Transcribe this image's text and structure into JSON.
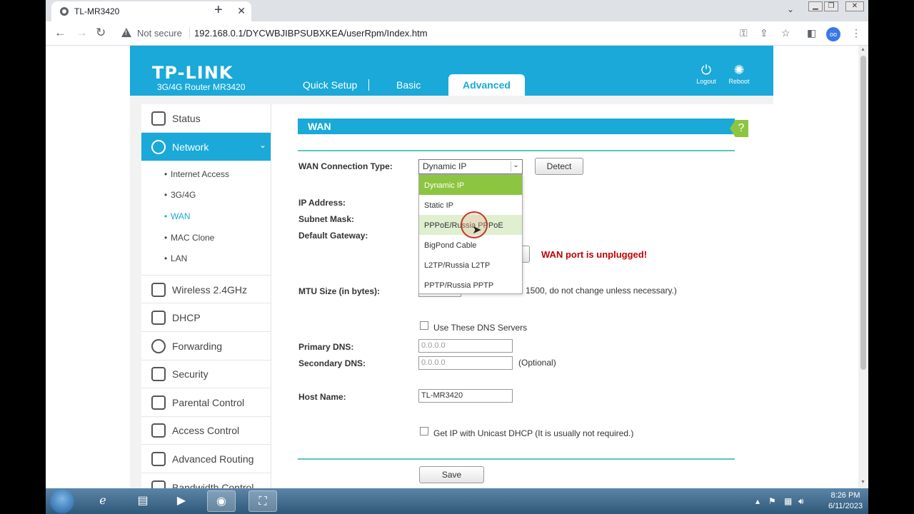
{
  "browser": {
    "tab_title": "TL-MR3420",
    "tab_close": "✕",
    "new_tab": "+",
    "tab_search": "⌄",
    "security_label": "Not secure",
    "url": "192.168.0.1/DYCWBJIBPSUBXKEA/userRpm/Index.htm",
    "profile": "oo"
  },
  "header": {
    "logo": "TP-LINK",
    "model": "3G/4G Router MR3420",
    "nav": [
      "Quick Setup",
      "Basic",
      "Advanced"
    ],
    "logout_label": "Logout",
    "reboot_label": "Reboot"
  },
  "sidebar": {
    "items": [
      {
        "label": "Status"
      },
      {
        "label": "Network"
      },
      {
        "label": "Wireless 2.4GHz"
      },
      {
        "label": "DHCP"
      },
      {
        "label": "Forwarding"
      },
      {
        "label": "Security"
      },
      {
        "label": "Parental Control"
      },
      {
        "label": "Access Control"
      },
      {
        "label": "Advanced Routing"
      },
      {
        "label": "Bandwidth Control"
      }
    ],
    "network_sub": [
      "Internet Access",
      "3G/4G",
      "WAN",
      "MAC Clone",
      "LAN"
    ]
  },
  "wan": {
    "title": "WAN",
    "help": "?",
    "connection_type_label": "WAN Connection Type:",
    "connection_type_value": "Dynamic IP",
    "detect_label": "Detect",
    "dropdown_options": [
      "Dynamic IP",
      "Static IP",
      "PPPoE/Russia PPPoE",
      "BigPond Cable",
      "L2TP/Russia L2TP",
      "PPTP/Russia PPTP"
    ],
    "ip_label": "IP Address:",
    "subnet_label": "Subnet Mask:",
    "gateway_label": "Default Gateway:",
    "warning": "WAN port is unplugged!",
    "mtu_label": "MTU Size (in bytes):",
    "mtu_hint": "1500, do not change unless necessary.)",
    "dns_checkbox_label": "Use These DNS Servers",
    "primary_dns_label": "Primary DNS:",
    "primary_dns_value": "0.0.0.0",
    "secondary_dns_label": "Secondary DNS:",
    "secondary_dns_value": "0.0.0.0",
    "optional_label": "(Optional)",
    "host_name_label": "Host Name:",
    "host_name_value": "TL-MR3420",
    "unicast_label": "Get IP with Unicast DHCP (It is usually not required.)",
    "save_label": "Save"
  },
  "taskbar": {
    "time": "8:26 PM",
    "date": "6/11/2023"
  },
  "colors": {
    "accent": "#1aa9d8",
    "selected_option": "#8cc540",
    "warning": "#c00000"
  }
}
